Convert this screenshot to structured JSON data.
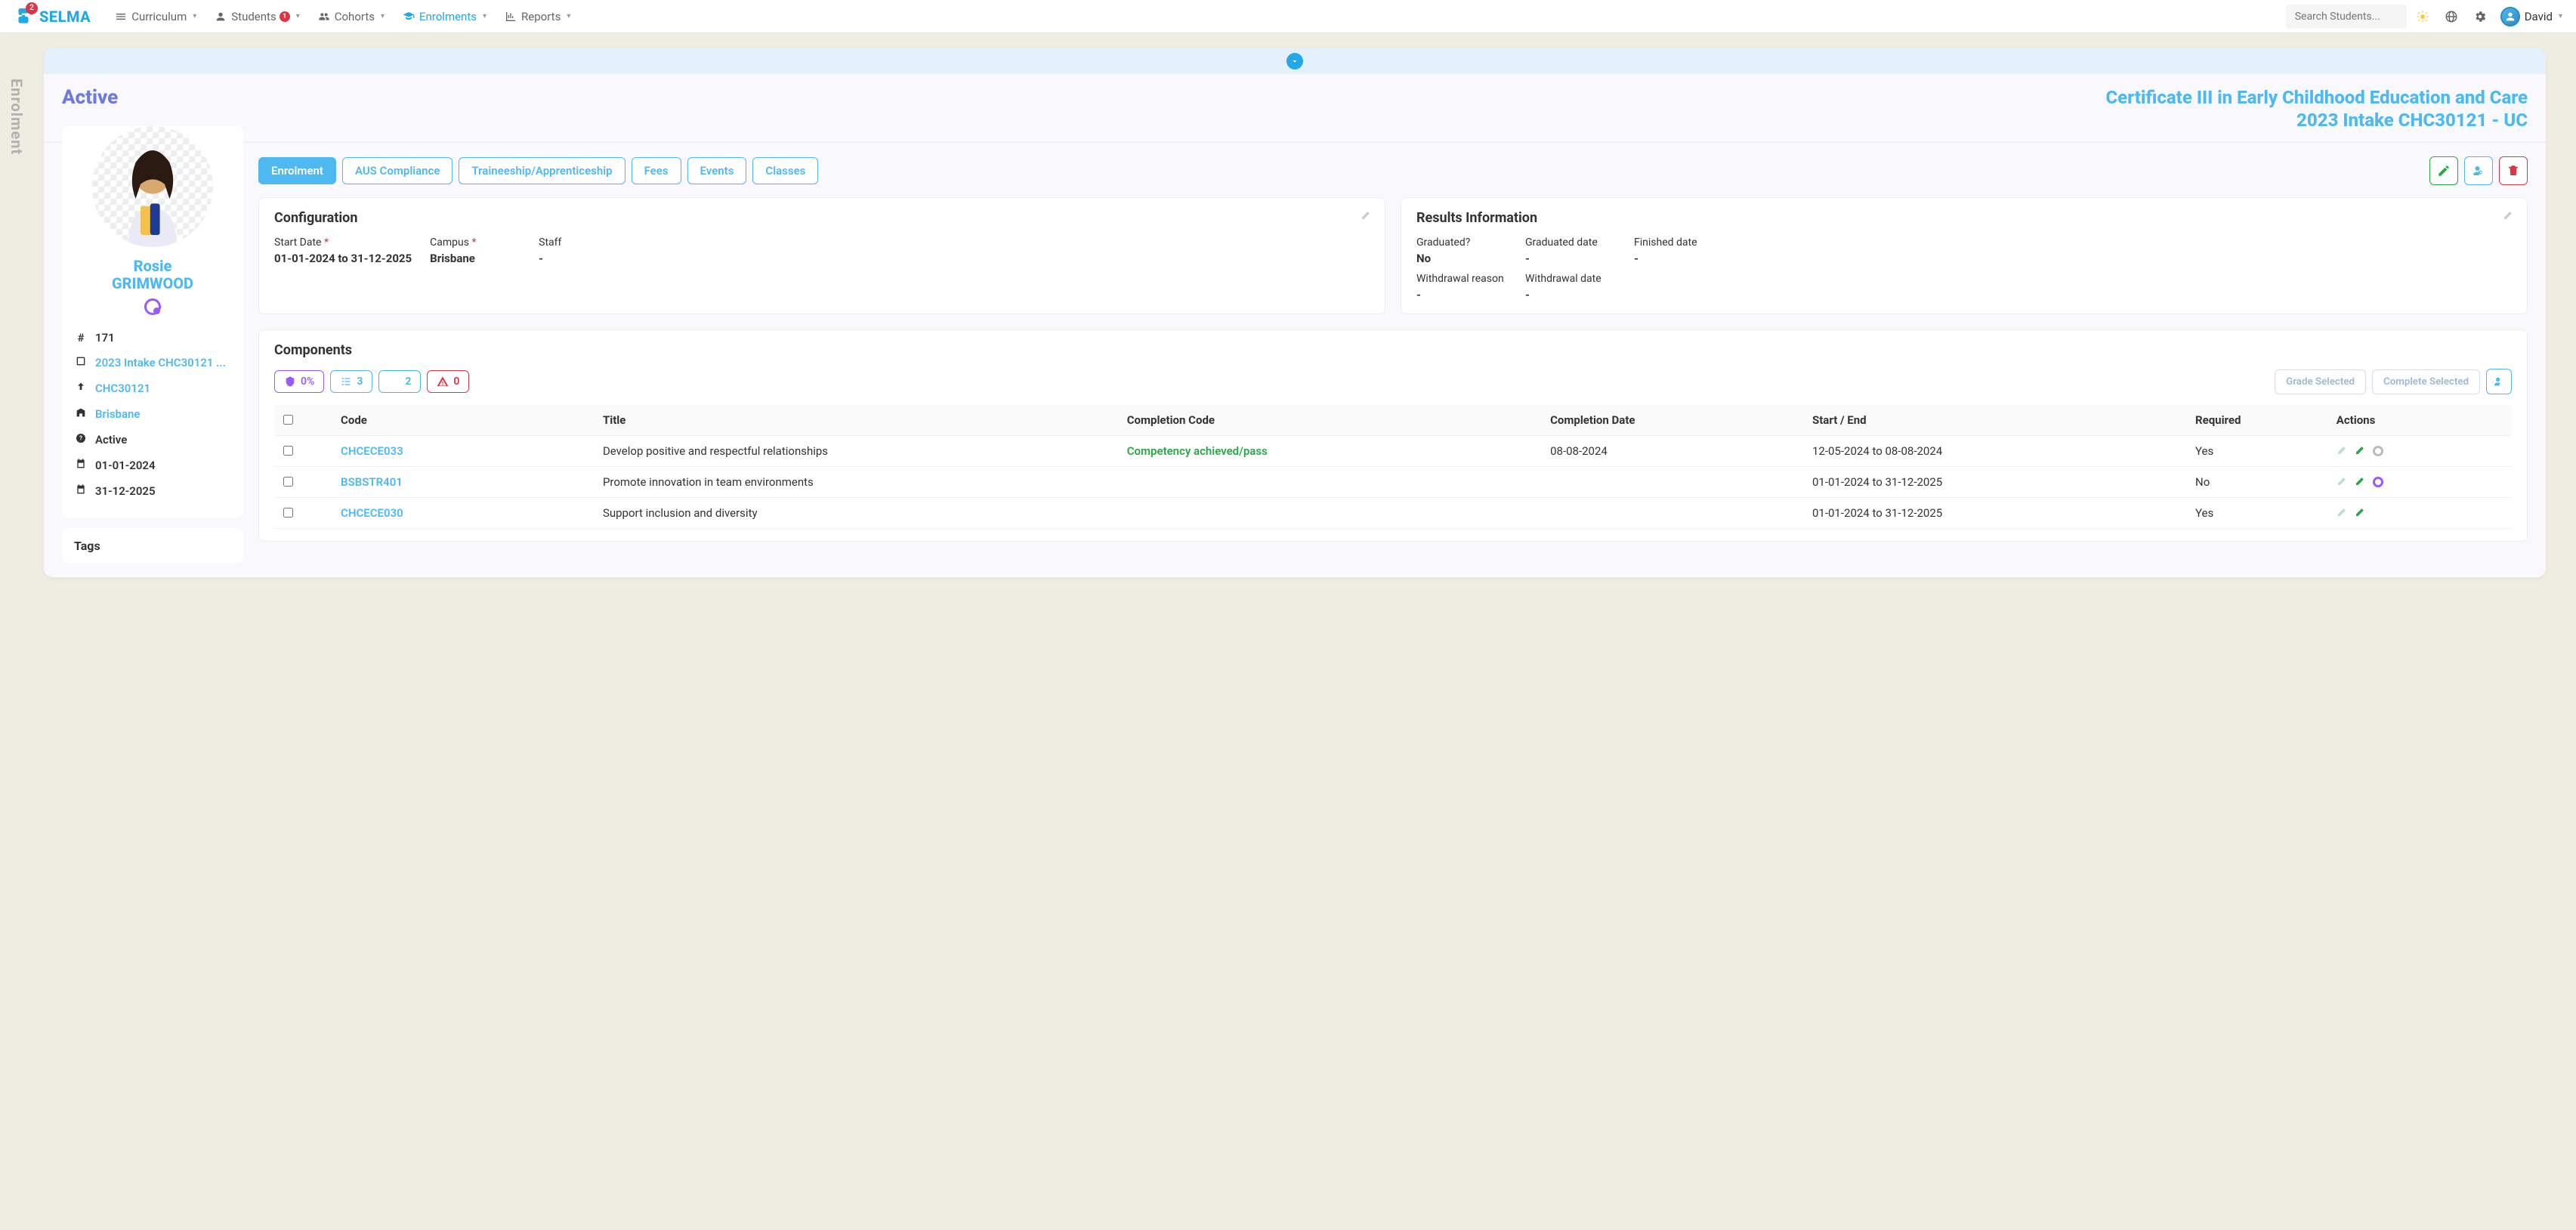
{
  "brand": "SELMA",
  "brand_badge": "2",
  "nav": {
    "curriculum": "Curriculum",
    "students": "Students",
    "students_badge": "1",
    "cohorts": "Cohorts",
    "enrolments": "Enrolments",
    "reports": "Reports"
  },
  "search_placeholder": "Search Students...",
  "user_name": "David",
  "side_label": "Enrolment",
  "header": {
    "status": "Active",
    "course_line1": "Certificate III in Early Childhood Education and Care",
    "course_line2": "2023 Intake CHC30121 - UC"
  },
  "student": {
    "first": "Rosie",
    "last": "GRIMWOOD",
    "id": "171",
    "intake": "2023 Intake CHC30121 ...",
    "code": "CHC30121",
    "campus": "Brisbane",
    "status": "Active",
    "start": "01-01-2024",
    "end": "31-12-2025"
  },
  "tags_title": "Tags",
  "tabs": {
    "enrolment": "Enrolment",
    "aus": "AUS Compliance",
    "trainee": "Traineeship/Apprenticeship",
    "fees": "Fees",
    "events": "Events",
    "classes": "Classes"
  },
  "config": {
    "title": "Configuration",
    "start_label": "Start Date",
    "start_val": "01-01-2024 to 31-12-2025",
    "campus_label": "Campus",
    "campus_val": "Brisbane",
    "staff_label": "Staff",
    "staff_val": "-"
  },
  "results": {
    "title": "Results Information",
    "grad_label": "Graduated?",
    "grad_val": "No",
    "grad_date_label": "Graduated date",
    "grad_date_val": "-",
    "fin_date_label": "Finished date",
    "fin_date_val": "-",
    "wr_label": "Withdrawal reason",
    "wr_val": "-",
    "wd_label": "Withdrawal date",
    "wd_val": "-"
  },
  "components": {
    "title": "Components",
    "pct": "0%",
    "count": "3",
    "star": "2",
    "warn": "0",
    "grade_btn": "Grade Selected",
    "complete_btn": "Complete Selected",
    "cols": {
      "code": "Code",
      "title": "Title",
      "completion": "Completion Code",
      "date": "Completion Date",
      "startend": "Start / End",
      "required": "Required",
      "actions": "Actions"
    },
    "rows": [
      {
        "code": "CHCECE033",
        "title": "Develop positive and respectful relationships",
        "completion": "Competency achieved/pass",
        "date": "08-08-2024",
        "startend": "12-05-2024 to 08-08-2024",
        "required": "Yes",
        "donut": "grey"
      },
      {
        "code": "BSBSTR401",
        "title": "Promote innovation in team environments",
        "completion": "",
        "date": "",
        "startend": "01-01-2024 to 31-12-2025",
        "required": "No",
        "donut": "purple"
      },
      {
        "code": "CHCECE030",
        "title": "Support inclusion and diversity",
        "completion": "",
        "date": "",
        "startend": "01-01-2024 to 31-12-2025",
        "required": "Yes",
        "donut": ""
      }
    ]
  }
}
